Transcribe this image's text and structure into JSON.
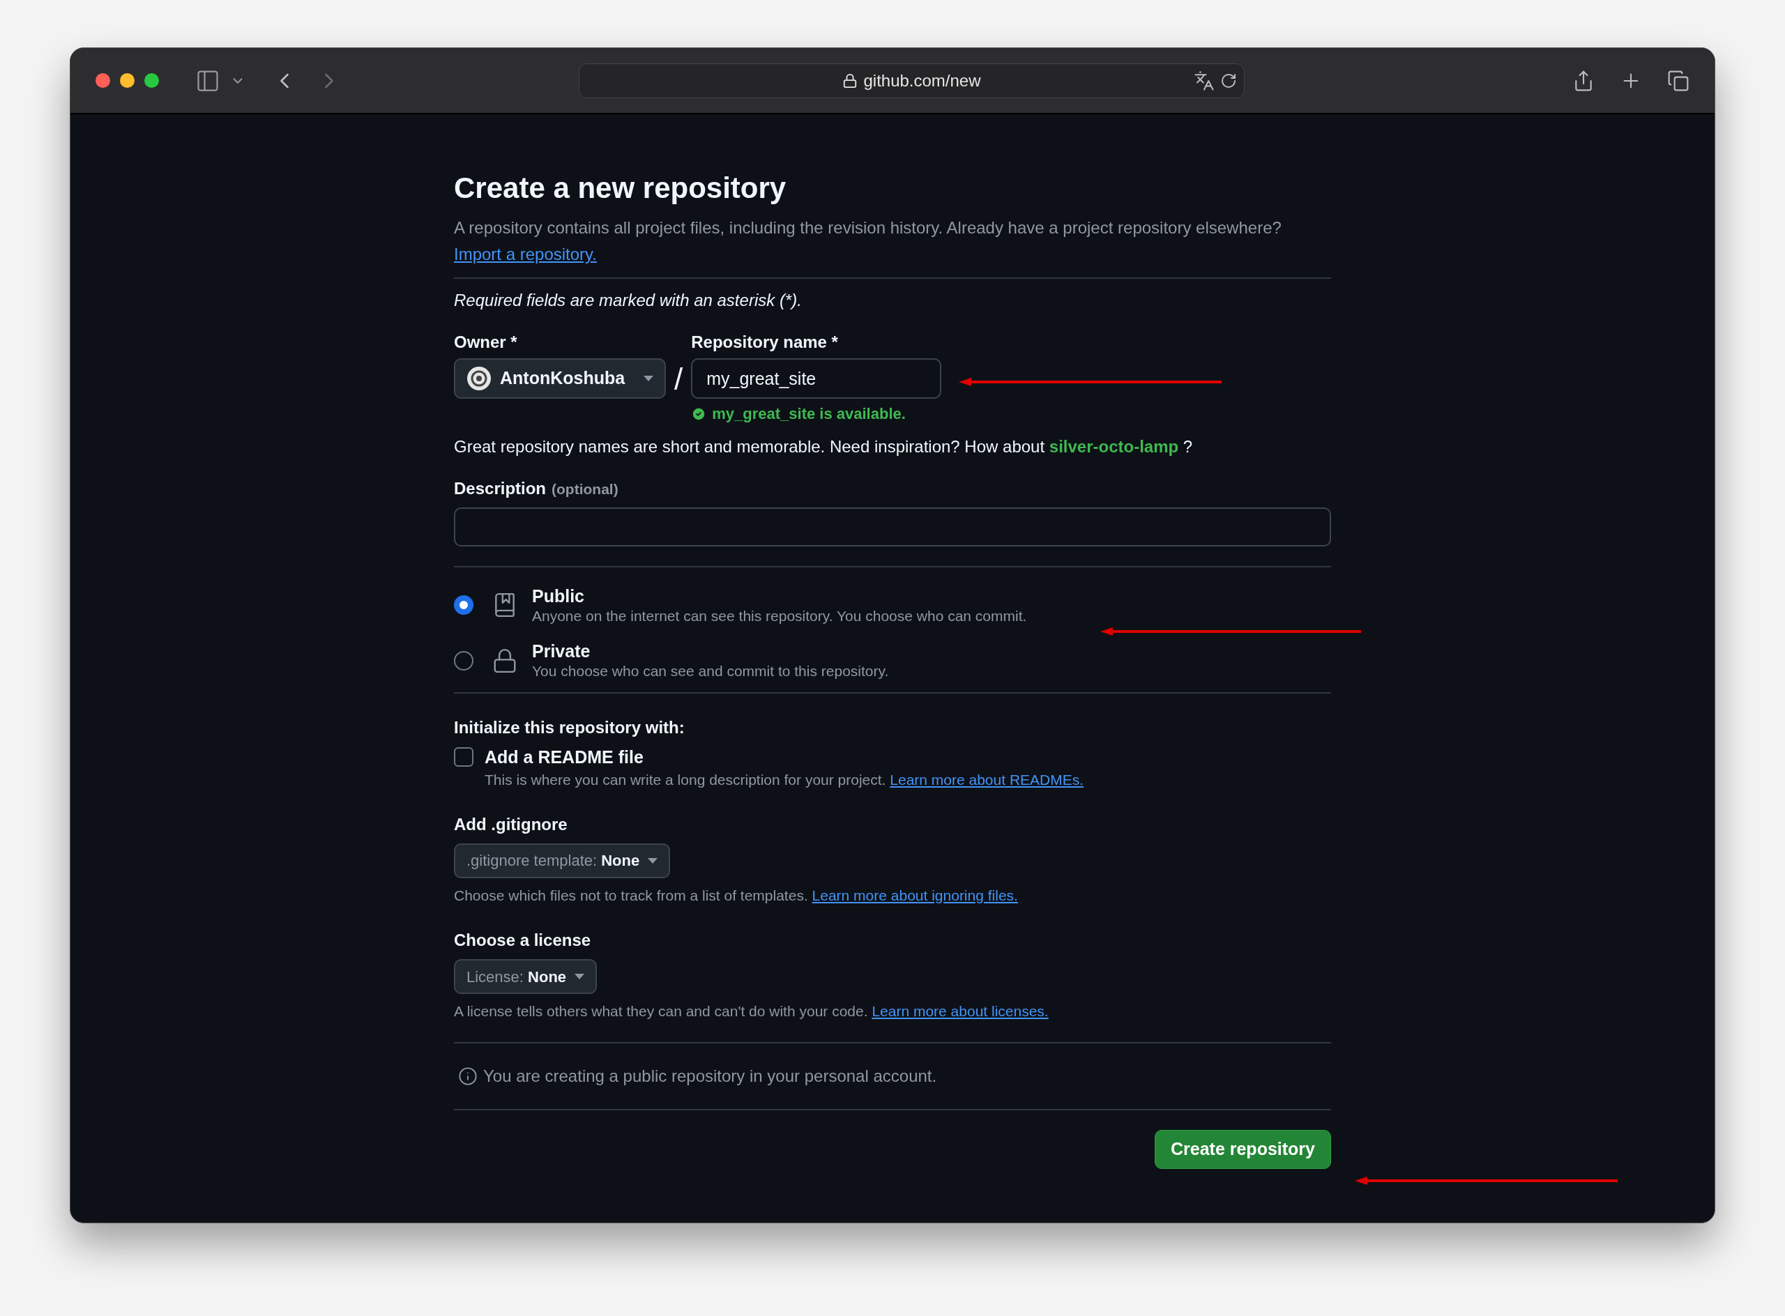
{
  "browser": {
    "url": "github.com/new"
  },
  "page": {
    "title": "Create a new repository",
    "intro": "A repository contains all project files, including the revision history. Already have a project repository elsewhere?",
    "import_link": "Import a repository.",
    "required_note": "Required fields are marked with an asterisk (*).",
    "owner": {
      "label": "Owner *",
      "value": "AntonKoshuba"
    },
    "separator": "/",
    "repo_name": {
      "label": "Repository name *",
      "value": "my_great_site",
      "status": "my_great_site is available."
    },
    "suggestion": {
      "text": "Great repository names are short and memorable. Need inspiration? How about",
      "name": "silver-octo-lamp",
      "end": "?"
    },
    "description": {
      "label": "Description",
      "hint": "(optional)"
    },
    "visibility": [
      {
        "kind": "repo",
        "title": "Public",
        "text": "Anyone on the internet can see this repository. You choose who can commit.",
        "selected": true
      },
      {
        "kind": "lock",
        "title": "Private",
        "text": "You choose who can see and commit to this repository.",
        "selected": false
      }
    ],
    "init": {
      "heading": "Initialize this repository with:",
      "readme": {
        "label": "Add a README file",
        "checked": false,
        "text": "This is where you can write a long description for your project.",
        "link": "Learn more about READMEs."
      }
    },
    "gitignore": {
      "heading": "Add .gitignore",
      "prefix": ".gitignore template:",
      "value": "None",
      "text": "Choose which files not to track from a list of templates.",
      "link": "Learn more about ignoring files."
    },
    "license": {
      "heading": "Choose a license",
      "prefix": "License:",
      "value": "None",
      "text": "A license tells others what they can and can't do with your code.",
      "link": "Learn more about licenses."
    },
    "notice": "You are creating a public repository in your personal account.",
    "submit": "Create repository"
  }
}
